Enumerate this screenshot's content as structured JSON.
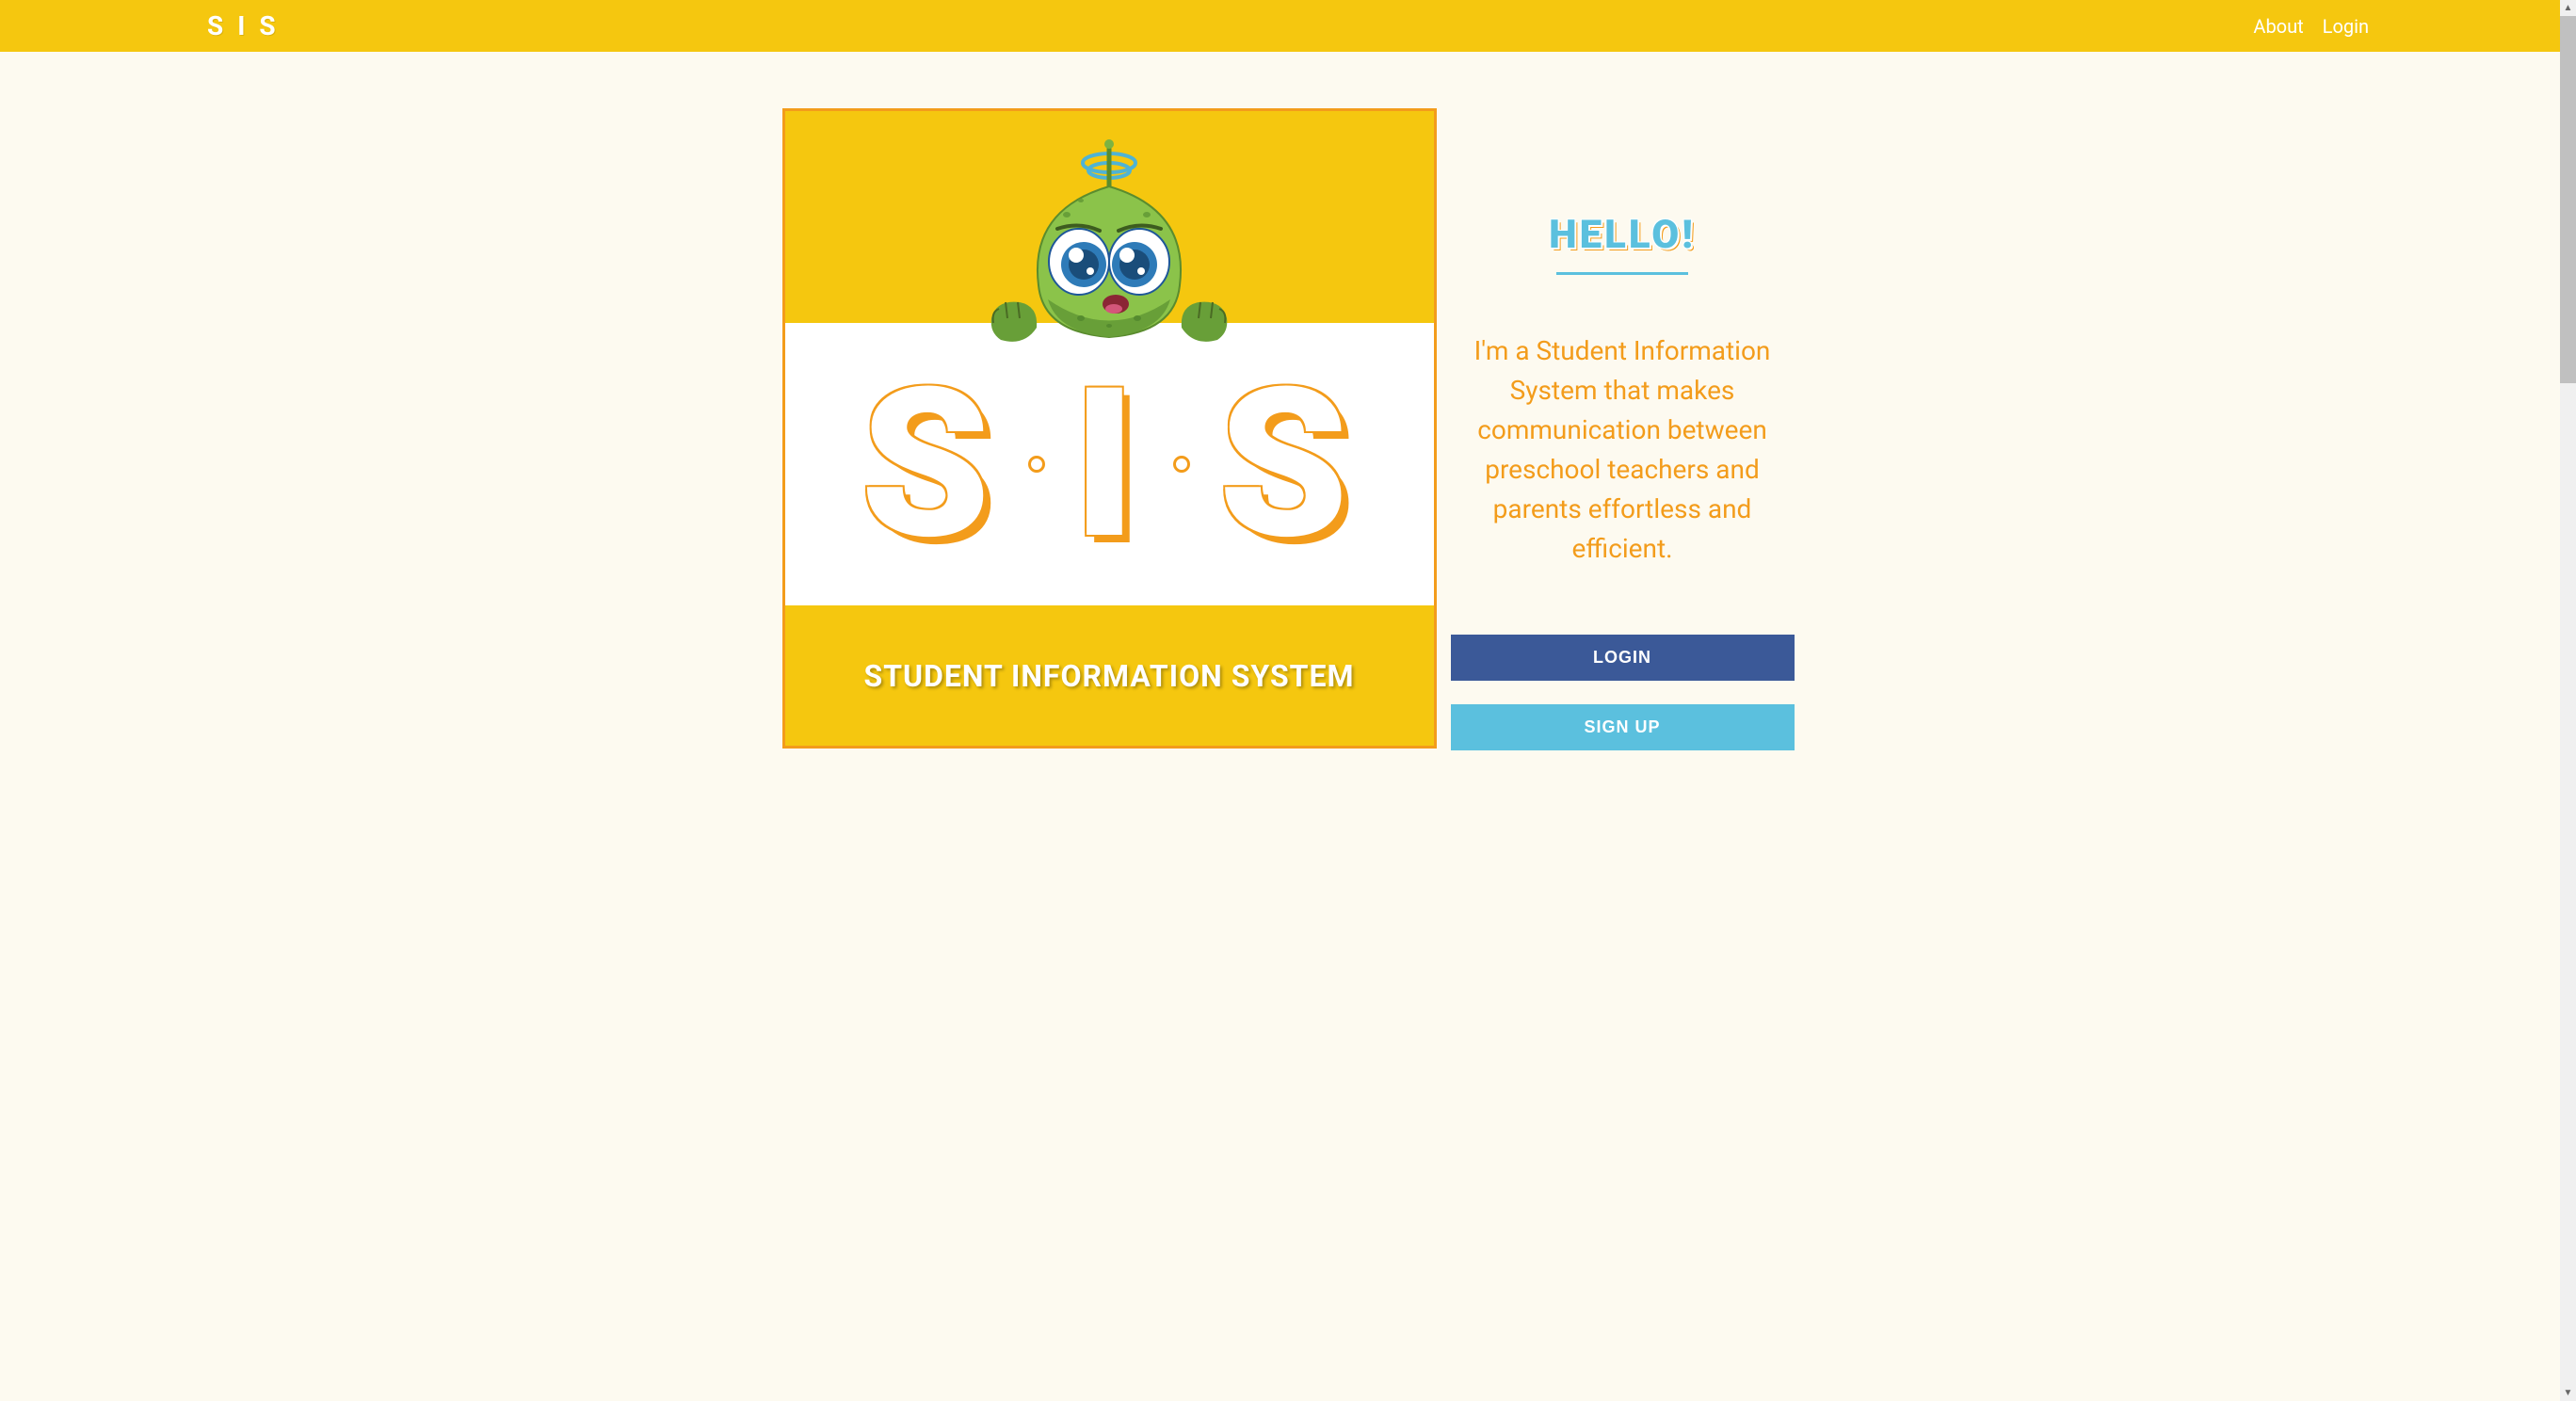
{
  "header": {
    "logo": "S I S",
    "nav": {
      "about": "About",
      "login": "Login"
    }
  },
  "hero": {
    "sis_letters": [
      "S",
      "I",
      "S"
    ],
    "subtitle": "STUDENT INFORMATION SYSTEM"
  },
  "content": {
    "hello": "HELLO!",
    "description": "I'm a Student Information System that makes communication between preschool teachers and parents effortless and efficient.",
    "login_button": "LOGIN",
    "signup_button": "SIGN UP"
  }
}
